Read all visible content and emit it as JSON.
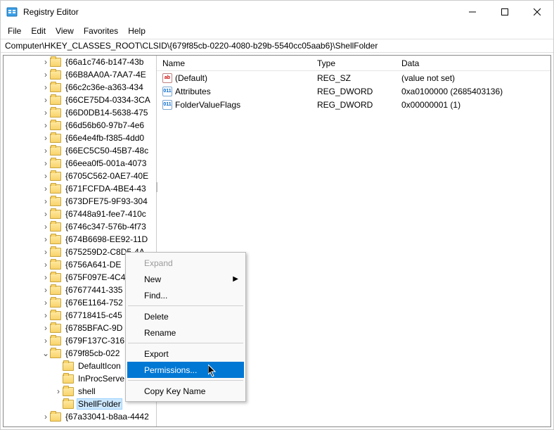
{
  "window": {
    "title": "Registry Editor"
  },
  "menu": {
    "file": "File",
    "edit": "Edit",
    "view": "View",
    "favorites": "Favorites",
    "help": "Help"
  },
  "address": "Computer\\HKEY_CLASSES_ROOT\\CLSID\\{679f85cb-0220-4080-b29b-5540cc05aab6}\\ShellFolder",
  "tree": {
    "items": [
      {
        "depth": 3,
        "toggle": ">",
        "label": "{66a1c746-b147-43b"
      },
      {
        "depth": 3,
        "toggle": ">",
        "label": "{66B8AA0A-7AA7-4E"
      },
      {
        "depth": 3,
        "toggle": ">",
        "label": "{66c2c36e-a363-434"
      },
      {
        "depth": 3,
        "toggle": ">",
        "label": "{66CE75D4-0334-3CA"
      },
      {
        "depth": 3,
        "toggle": ">",
        "label": "{66D0DB14-5638-475"
      },
      {
        "depth": 3,
        "toggle": ">",
        "label": "{66d56b60-97b7-4e6"
      },
      {
        "depth": 3,
        "toggle": ">",
        "label": "{66e4e4fb-f385-4dd0"
      },
      {
        "depth": 3,
        "toggle": ">",
        "label": "{66EC5C50-45B7-48c"
      },
      {
        "depth": 3,
        "toggle": ">",
        "label": "{66eea0f5-001a-4073"
      },
      {
        "depth": 3,
        "toggle": ">",
        "label": "{6705C562-0AE7-40E"
      },
      {
        "depth": 3,
        "toggle": ">",
        "label": "{671FCFDA-4BE4-43"
      },
      {
        "depth": 3,
        "toggle": ">",
        "label": "{673DFE75-9F93-304"
      },
      {
        "depth": 3,
        "toggle": ">",
        "label": "{67448a91-fee7-410c"
      },
      {
        "depth": 3,
        "toggle": ">",
        "label": "{6746c347-576b-4f73"
      },
      {
        "depth": 3,
        "toggle": ">",
        "label": "{674B6698-EE92-11D"
      },
      {
        "depth": 3,
        "toggle": ">",
        "label": "{675259D2-C8D5-4A"
      },
      {
        "depth": 3,
        "toggle": ">",
        "label": "{6756A641-DE"
      },
      {
        "depth": 3,
        "toggle": ">",
        "label": "{675F097E-4C4"
      },
      {
        "depth": 3,
        "toggle": ">",
        "label": "{67677441-335"
      },
      {
        "depth": 3,
        "toggle": ">",
        "label": "{676E1164-752"
      },
      {
        "depth": 3,
        "toggle": ">",
        "label": "{67718415-c45"
      },
      {
        "depth": 3,
        "toggle": ">",
        "label": "{6785BFAC-9D"
      },
      {
        "depth": 3,
        "toggle": ">",
        "label": "{679F137C-316"
      },
      {
        "depth": 3,
        "toggle": "v",
        "label": "{679f85cb-022"
      },
      {
        "depth": 4,
        "toggle": "",
        "label": "DefaultIcon"
      },
      {
        "depth": 4,
        "toggle": "",
        "label": "InProcServe"
      },
      {
        "depth": 4,
        "toggle": ">",
        "label": "shell"
      },
      {
        "depth": 4,
        "toggle": "",
        "label": "ShellFolder",
        "selected": true
      },
      {
        "depth": 3,
        "toggle": ">",
        "label": "{67a33041-b8aa-4442"
      }
    ]
  },
  "values": {
    "headers": {
      "name": "Name",
      "type": "Type",
      "data": "Data"
    },
    "rows": [
      {
        "icon": "sz",
        "iconText": "ab",
        "name": "(Default)",
        "type": "REG_SZ",
        "data": "(value not set)"
      },
      {
        "icon": "dw",
        "iconText": "011",
        "name": "Attributes",
        "type": "REG_DWORD",
        "data": "0xa0100000 (2685403136)"
      },
      {
        "icon": "dw",
        "iconText": "011",
        "name": "FolderValueFlags",
        "type": "REG_DWORD",
        "data": "0x00000001 (1)"
      }
    ]
  },
  "context": {
    "expand": "Expand",
    "new": "New",
    "find": "Find...",
    "delete": "Delete",
    "rename": "Rename",
    "export": "Export",
    "permissions": "Permissions...",
    "copykey": "Copy Key Name"
  }
}
